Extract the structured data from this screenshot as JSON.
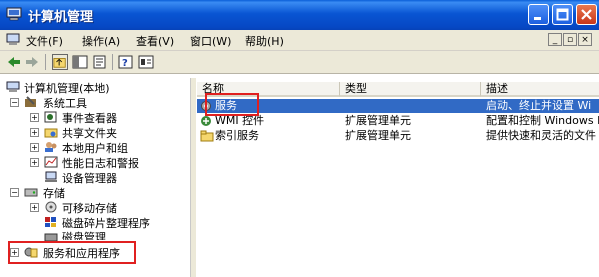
{
  "window": {
    "title": "计算机管理"
  },
  "menu": [
    "文件(F)",
    "操作(A)",
    "查看(V)",
    "窗口(W)",
    "帮助(H)"
  ],
  "tree": {
    "root": "计算机管理(本地)",
    "system_tools": "系统工具",
    "event_viewer": "事件查看器",
    "shared_folders": "共享文件夹",
    "local_users": "本地用户和组",
    "perf_logs": "性能日志和警报",
    "device_manager": "设备管理器",
    "storage": "存储",
    "removable": "可移动存储",
    "defrag": "磁盘碎片整理程序",
    "disk_mgmt": "磁盘管理",
    "services_apps": "服务和应用程序"
  },
  "list": {
    "columns": [
      "名称",
      "类型",
      "描述"
    ],
    "rows": [
      {
        "name": "服务",
        "type": "",
        "desc": "启动、终止并设置 Wi"
      },
      {
        "name": "WMI 控件",
        "type": "扩展管理单元",
        "desc": "配置和控制 Windows M"
      },
      {
        "name": "索引服务",
        "type": "扩展管理单元",
        "desc": "提供快速和灵活的文件"
      }
    ]
  }
}
